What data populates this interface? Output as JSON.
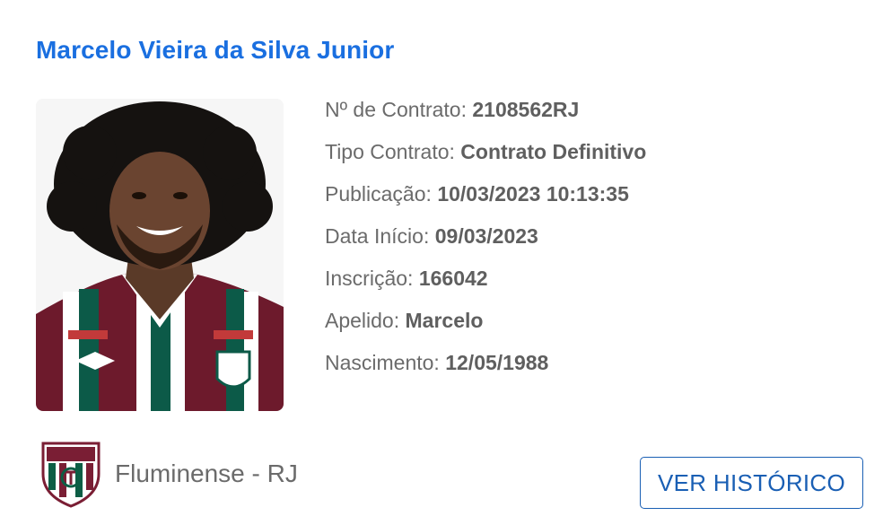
{
  "player": {
    "name": "Marcelo Vieira da Silva Junior"
  },
  "details": [
    {
      "label": "Nº de Contrato:",
      "value": "2108562RJ"
    },
    {
      "label": "Tipo Contrato:",
      "value": "Contrato Definitivo"
    },
    {
      "label": "Publicação:",
      "value": "10/03/2023 10:13:35"
    },
    {
      "label": "Data Início:",
      "value": "09/03/2023"
    },
    {
      "label": "Inscrição:",
      "value": "166042"
    },
    {
      "label": "Apelido:",
      "value": "Marcelo"
    },
    {
      "label": "Nascimento:",
      "value": "12/05/1988"
    }
  ],
  "club": {
    "name": "Fluminense - RJ",
    "crest_icon": "fluminense-crest-icon"
  },
  "actions": {
    "history_label": "VER HISTÓRICO"
  },
  "colors": {
    "name_link": "#1a6fe0",
    "button": "#1a5fb4",
    "text": "#6b6b6b",
    "club_maroon": "#7a1e34",
    "club_green": "#0d5e45"
  }
}
